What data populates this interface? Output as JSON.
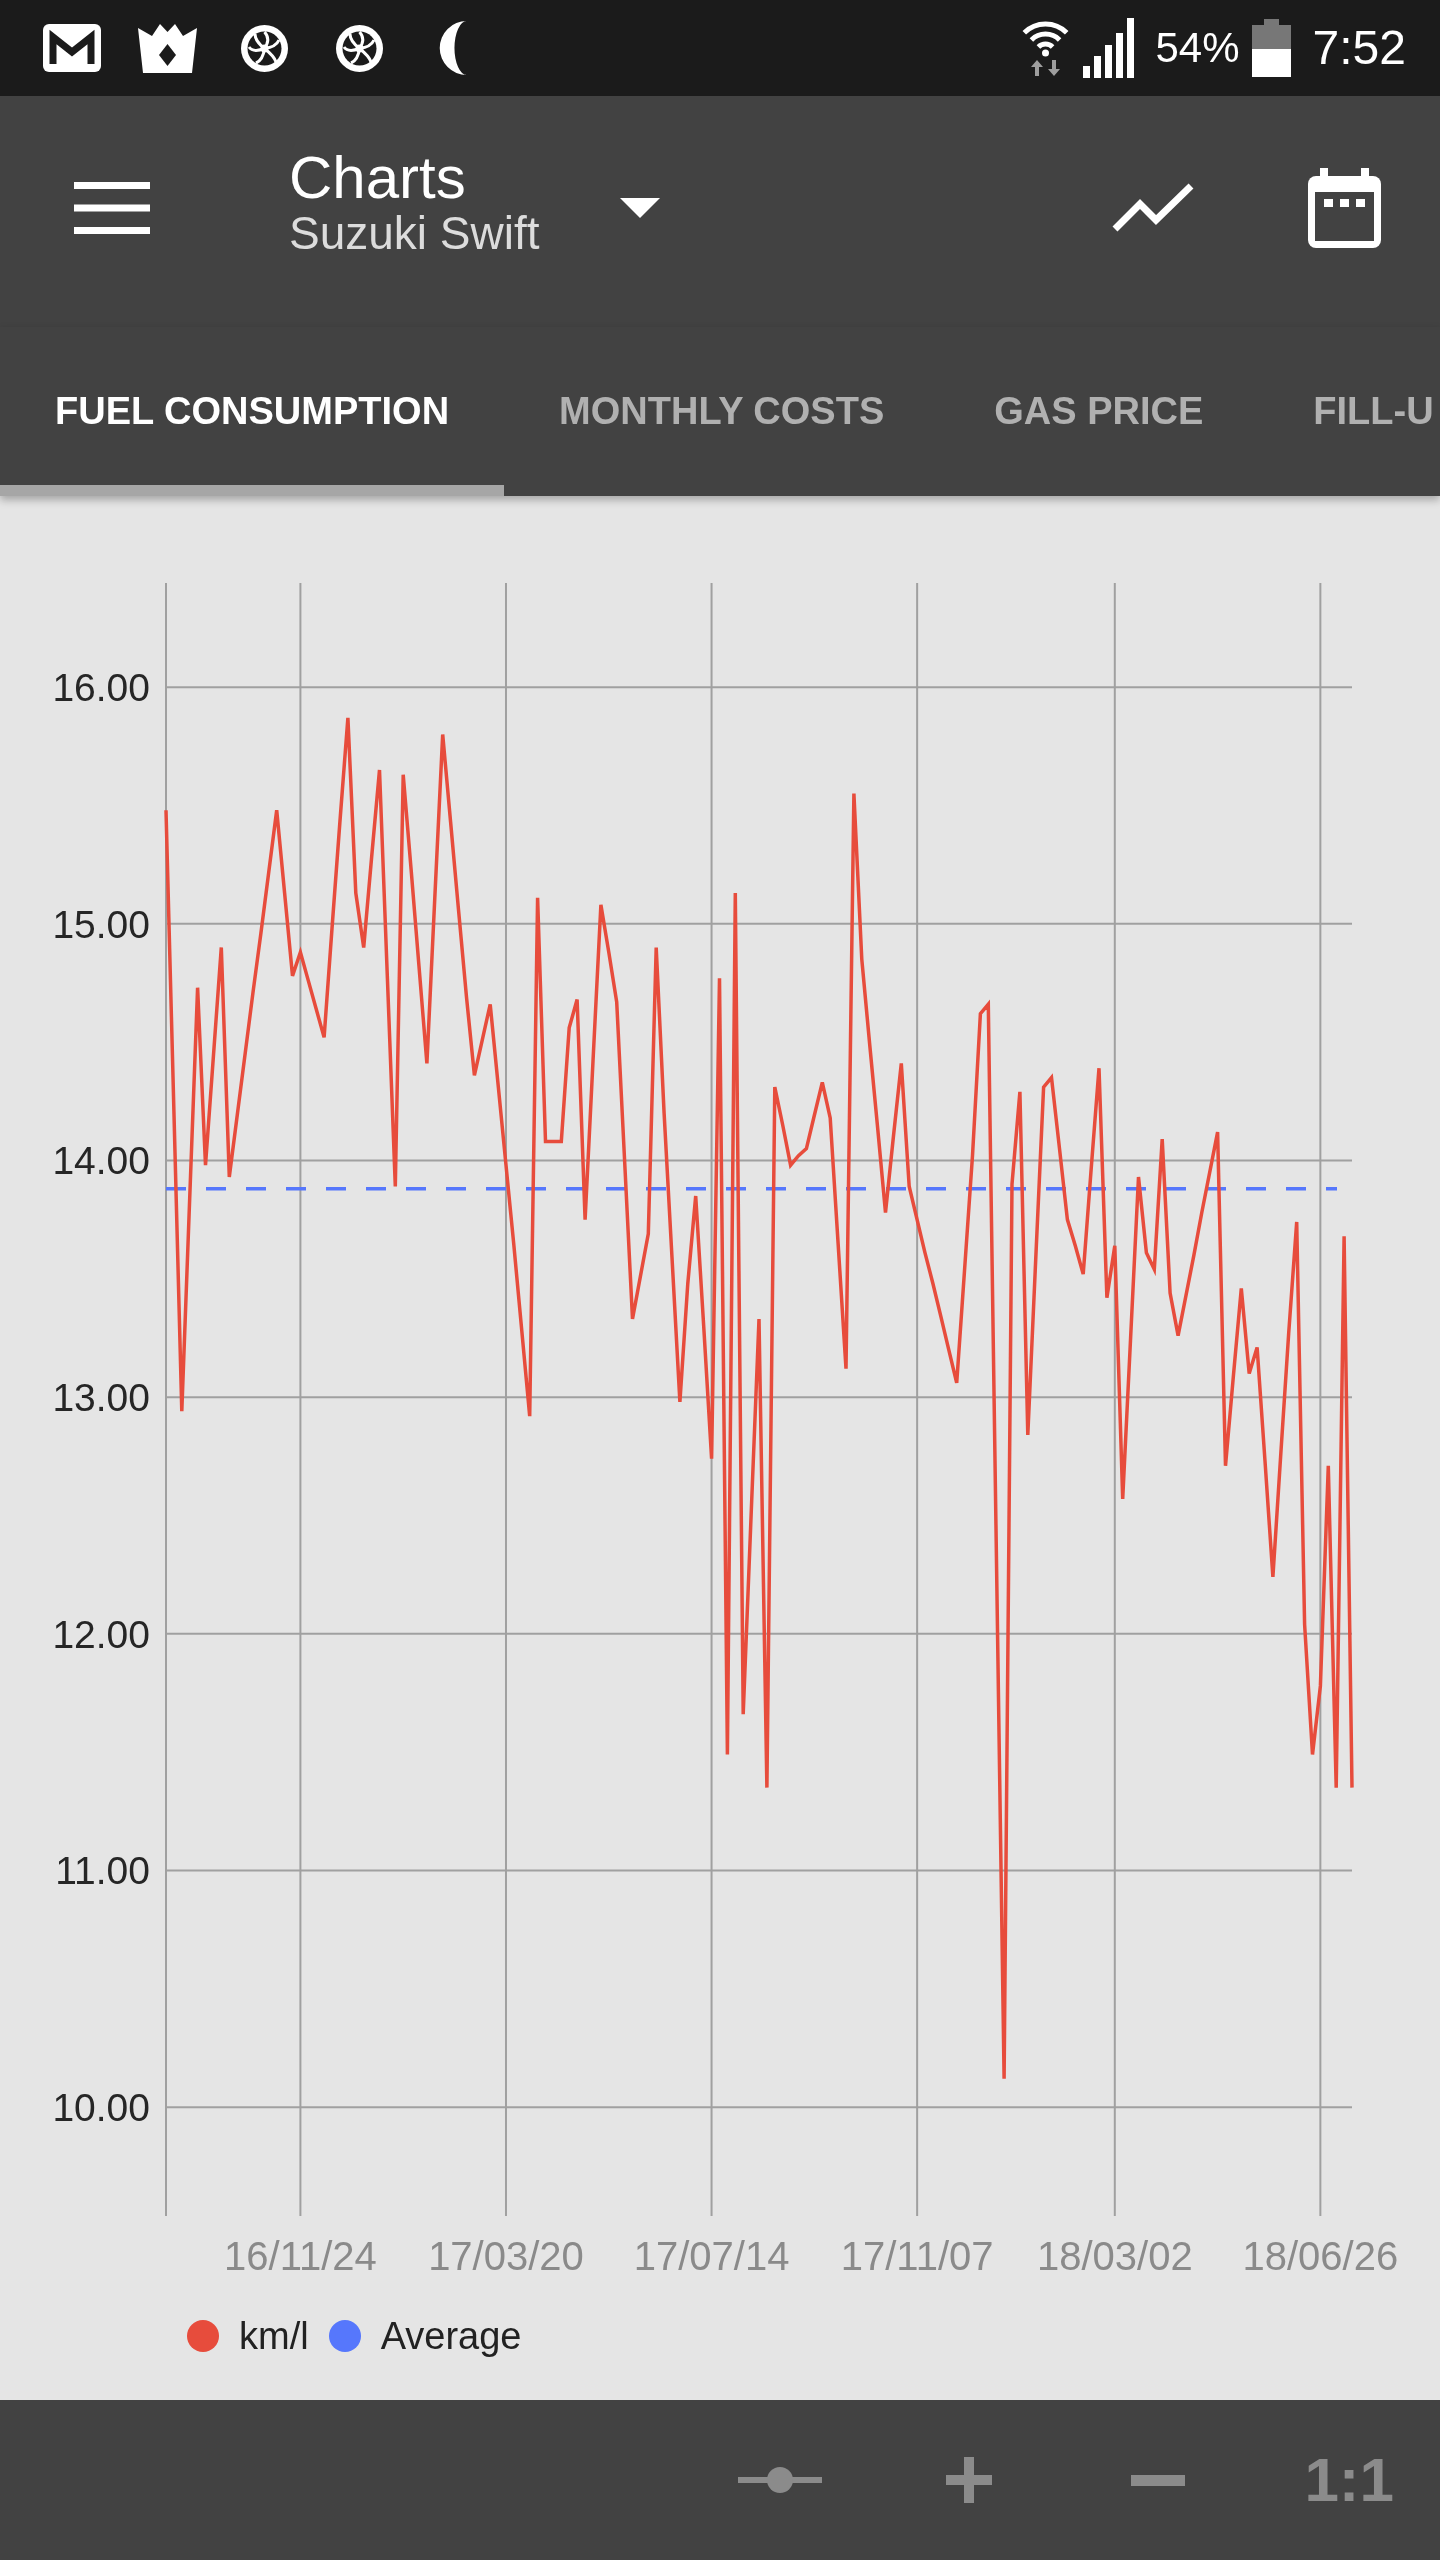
{
  "status_bar": {
    "battery": "54%",
    "time": "7:52"
  },
  "toolbar": {
    "title": "Charts",
    "subtitle": "Suzuki Swift"
  },
  "tabs": [
    {
      "label": "FUEL CONSUMPTION",
      "selected": true
    },
    {
      "label": "MONTHLY COSTS",
      "selected": false
    },
    {
      "label": "GAS PRICE",
      "selected": false
    },
    {
      "label": "FILL-U",
      "selected": false
    }
  ],
  "chart": {
    "chart_data": {
      "type": "line",
      "grid": true,
      "categories": [
        null,
        null,
        null,
        null,
        null,
        null,
        null,
        null,
        null,
        null,
        null,
        null,
        null,
        null,
        null,
        null,
        null,
        "16/11/24",
        null,
        null,
        null,
        null,
        null,
        null,
        null,
        null,
        null,
        null,
        null,
        null,
        null,
        null,
        null,
        null,
        null,
        null,
        null,
        null,
        null,
        null,
        null,
        null,
        null,
        "17/03/20",
        null,
        null,
        null,
        null,
        null,
        null,
        null,
        null,
        null,
        null,
        null,
        null,
        null,
        null,
        null,
        null,
        null,
        null,
        null,
        null,
        null,
        null,
        null,
        null,
        null,
        "17/07/14",
        null,
        null,
        null,
        null,
        null,
        null,
        null,
        null,
        null,
        null,
        null,
        null,
        null,
        null,
        null,
        null,
        null,
        null,
        null,
        null,
        null,
        null,
        null,
        null,
        null,
        "17/11/07",
        null,
        null,
        null,
        null,
        null,
        null,
        null,
        null,
        null,
        null,
        null,
        null,
        null,
        null,
        null,
        null,
        null,
        null,
        null,
        null,
        null,
        null,
        null,
        null,
        "18/03/02",
        null,
        null,
        null,
        null,
        null,
        null,
        null,
        null,
        null,
        null,
        null,
        null,
        null,
        null,
        null,
        null,
        null,
        null,
        null,
        null,
        null,
        null,
        null,
        null,
        null,
        "18/06/26",
        null,
        null,
        null,
        null
      ],
      "series": [
        {
          "name": "km/l",
          "color": "#e74c3c",
          "values": [
            15.48,
            14.21,
            12.94,
            13.84,
            14.73,
            13.98,
            14.44,
            14.9,
            13.93,
            14.19,
            14.45,
            14.71,
            14.96,
            15.22,
            15.48,
            15.13,
            14.78,
            14.88,
            14.76,
            14.64,
            14.52,
            14.98,
            15.43,
            15.87,
            15.13,
            14.9,
            15.28,
            15.65,
            14.77,
            13.89,
            15.63,
            15.23,
            14.82,
            14.41,
            15.11,
            15.8,
            15.43,
            15.06,
            14.69,
            14.36,
            14.51,
            14.66,
            14.32,
            13.98,
            13.64,
            13.28,
            12.92,
            15.11,
            14.08,
            14.08,
            14.08,
            14.56,
            14.68,
            13.75,
            14.42,
            15.08,
            14.88,
            14.67,
            14,
            13.33,
            13.51,
            13.69,
            14.9,
            14.2,
            13.59,
            12.98,
            13.48,
            13.85,
            13.3,
            12.74,
            14.77,
            11.49,
            15.13,
            11.66,
            12.5,
            13.33,
            11.35,
            14.31,
            14.15,
            13.98,
            14.02,
            14.05,
            14.19,
            14.33,
            14.18,
            13.65,
            13.12,
            15.55,
            14.85,
            14.49,
            14.14,
            13.78,
            14.1,
            14.41,
            13.89,
            13.75,
            13.61,
            13.48,
            13.34,
            13.2,
            13.06,
            13.54,
            14.02,
            14.62,
            14.66,
            12.39,
            10.12,
            13.9,
            14.29,
            12.84,
            13.58,
            14.31,
            14.35,
            14.05,
            13.75,
            13.64,
            13.52,
            13.96,
            14.39,
            13.42,
            13.64,
            12.57,
            13.25,
            13.93,
            13.61,
            13.54,
            14.09,
            13.44,
            13.26,
            13.43,
            13.6,
            13.78,
            13.95,
            14.12,
            12.71,
            13.09,
            13.46,
            13.1,
            13.21,
            12.73,
            12.24,
            12.76,
            13.27,
            13.74,
            12.04,
            11.49,
            11.78,
            12.71,
            11.35,
            13.68,
            11.35
          ]
        }
      ],
      "ref_lines": [
        {
          "axis": "y",
          "value": 13.88,
          "label": "Average",
          "color": "#5677fc"
        }
      ],
      "ylim": [
        9.54,
        16.44
      ],
      "yticks": [
        {
          "value": 10,
          "label": "10.00"
        },
        {
          "value": 11,
          "label": "11.00"
        },
        {
          "value": 12,
          "label": "12.00"
        },
        {
          "value": 13,
          "label": "13.00"
        },
        {
          "value": 14,
          "label": "14.00"
        },
        {
          "value": 15,
          "label": "15.00"
        },
        {
          "value": 16,
          "label": "16.00"
        }
      ]
    }
  },
  "bottom_bar": {
    "reset_zoom": "1:1"
  }
}
